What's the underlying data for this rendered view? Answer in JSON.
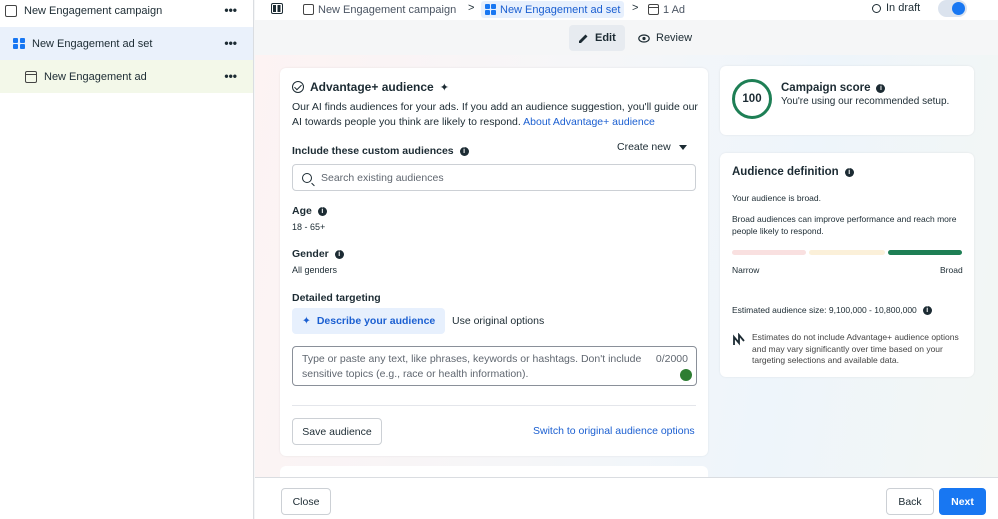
{
  "sidebar": {
    "items": [
      {
        "label": "New Engagement campaign",
        "type": "campaign",
        "menu": "•••"
      },
      {
        "label": "New Engagement ad set",
        "type": "adset",
        "menu": "•••"
      },
      {
        "label": "New Engagement ad",
        "type": "ad",
        "menu": "•••"
      }
    ]
  },
  "topbar": {
    "breadcrumbs": [
      "New Engagement campaign",
      "New Engagement ad set",
      "1 Ad"
    ],
    "separator": ">",
    "status": "In draft"
  },
  "modes": {
    "edit": "Edit",
    "review": "Review"
  },
  "audience": {
    "title": "Advantage+ audience",
    "description": "Our AI finds audiences for your ads. If you add an audience suggestion, you'll guide our AI towards people you think are likely to respond.",
    "description_link": "About Advantage+ audience",
    "custom_label": "Include these custom audiences",
    "create_new": "Create new",
    "search_placeholder": "Search existing audiences",
    "age_label": "Age",
    "age_value": "18 - 65+",
    "gender_label": "Gender",
    "gender_value": "All genders",
    "detailed_label": "Detailed targeting",
    "describe_btn": "Describe your audience",
    "original_btn": "Use original options",
    "textarea_placeholder": "Type or paste any text, like phrases, keywords or hashtags. Don't include sensitive topics (e.g., race or health information).",
    "textarea_count": "0/2000",
    "save_btn": "Save audience",
    "switch_link": "Switch to original audience options"
  },
  "score": {
    "value": "100",
    "title": "Campaign score",
    "subtitle": "You're using our recommended setup."
  },
  "definition": {
    "title": "Audience definition",
    "broad": "Your audience is broad.",
    "explain": "Broad audiences can improve performance and reach more people likely to respond.",
    "narrow_label": "Narrow",
    "broad_label": "Broad",
    "estimate": "Estimated audience size: 9,100,000 - 10,800,000",
    "note": "Estimates do not include Advantage+ audience options and may vary significantly over time based on your targeting selections and available data."
  },
  "footer": {
    "close": "Close",
    "back": "Back",
    "next": "Next"
  },
  "colors": {
    "accent": "#1877f2",
    "score_green": "#1e7f55"
  }
}
